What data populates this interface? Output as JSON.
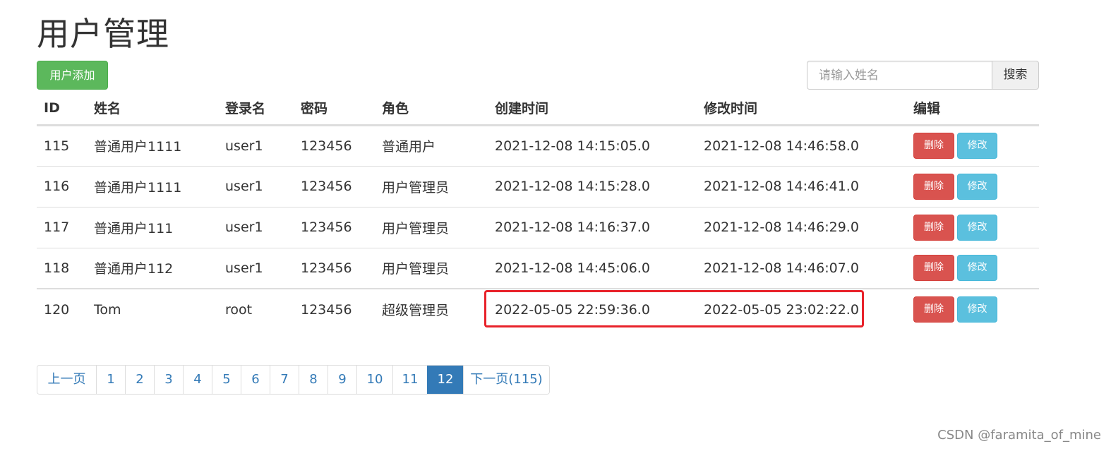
{
  "title": "用户管理",
  "toolbar": {
    "add_label": "用户添加",
    "search_placeholder": "请输入姓名",
    "search_label": "搜索"
  },
  "table": {
    "headers": [
      "ID",
      "姓名",
      "登录名",
      "密码",
      "角色",
      "创建时间",
      "修改时间",
      "编辑"
    ],
    "rows": [
      {
        "id": "115",
        "name": "普通用户1111",
        "login": "user1",
        "password": "123456",
        "role": "普通用户",
        "created": "2021-12-08 14:15:05.0",
        "modified": "2021-12-08 14:46:58.0"
      },
      {
        "id": "116",
        "name": "普通用户1111",
        "login": "user1",
        "password": "123456",
        "role": "用户管理员",
        "created": "2021-12-08 14:15:28.0",
        "modified": "2021-12-08 14:46:41.0"
      },
      {
        "id": "117",
        "name": "普通用户111",
        "login": "user1",
        "password": "123456",
        "role": "用户管理员",
        "created": "2021-12-08 14:16:37.0",
        "modified": "2021-12-08 14:46:29.0"
      },
      {
        "id": "118",
        "name": "普通用户112",
        "login": "user1",
        "password": "123456",
        "role": "用户管理员",
        "created": "2021-12-08 14:45:06.0",
        "modified": "2021-12-08 14:46:07.0"
      },
      {
        "id": "120",
        "name": "Tom",
        "login": "root",
        "password": "123456",
        "role": "超级管理员",
        "created": "2022-05-05 22:59:36.0",
        "modified": "2022-05-05 23:02:22.0"
      }
    ],
    "delete_label": "删除",
    "modify_label": "修改"
  },
  "pagination": {
    "prev_label": "上一页",
    "pages": [
      "1",
      "2",
      "3",
      "4",
      "5",
      "6",
      "7",
      "8",
      "9",
      "10",
      "11",
      "12"
    ],
    "active_page": "12",
    "next_label": "下一页(115)"
  },
  "watermark": "CSDN @faramita_of_mine",
  "colors": {
    "add_button": "#5cb85c",
    "delete_button": "#d9534f",
    "modify_button": "#5bc0de",
    "active_page": "#337ab7",
    "highlight_box": "#e8222a"
  }
}
